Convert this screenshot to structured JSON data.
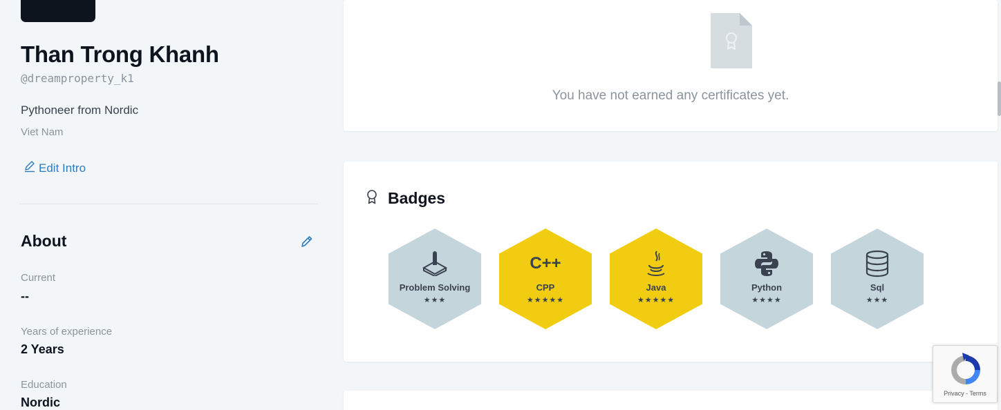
{
  "profile": {
    "name": "Than Trong Khanh",
    "handle": "@dreamproperty_k1",
    "bio": "Pythoneer from Nordic",
    "country": "Viet Nam",
    "edit_intro_label": "Edit Intro"
  },
  "about": {
    "title": "About",
    "fields": [
      {
        "label": "Current",
        "value": "--"
      },
      {
        "label": "Years of experience",
        "value": "2 Years"
      },
      {
        "label": "Education",
        "value": "Nordic"
      }
    ]
  },
  "certificates": {
    "empty_message": "You have not earned any certificates yet."
  },
  "badges": {
    "title": "Badges",
    "items": [
      {
        "name": "Problem Solving",
        "stars": "★★★",
        "level": "silver",
        "icon": "problem-solving-icon"
      },
      {
        "name": "CPP",
        "stars": "★★★★★",
        "level": "gold",
        "icon": "cpp-icon",
        "icon_text": "C++"
      },
      {
        "name": "Java",
        "stars": "★★★★★",
        "level": "gold",
        "icon": "java-icon"
      },
      {
        "name": "Python",
        "stars": "★★★★",
        "level": "silver",
        "icon": "python-icon"
      },
      {
        "name": "Sql",
        "stars": "★★★",
        "level": "silver",
        "icon": "sql-icon"
      }
    ]
  },
  "recaptcha": {
    "footer": "Privacy - Terms"
  },
  "colors": {
    "accent_link": "#2e7bbd",
    "badge_gold": "#f1cc10",
    "badge_silver": "#c5d5dc",
    "heading": "#0e141e",
    "muted": "#8b939b"
  }
}
